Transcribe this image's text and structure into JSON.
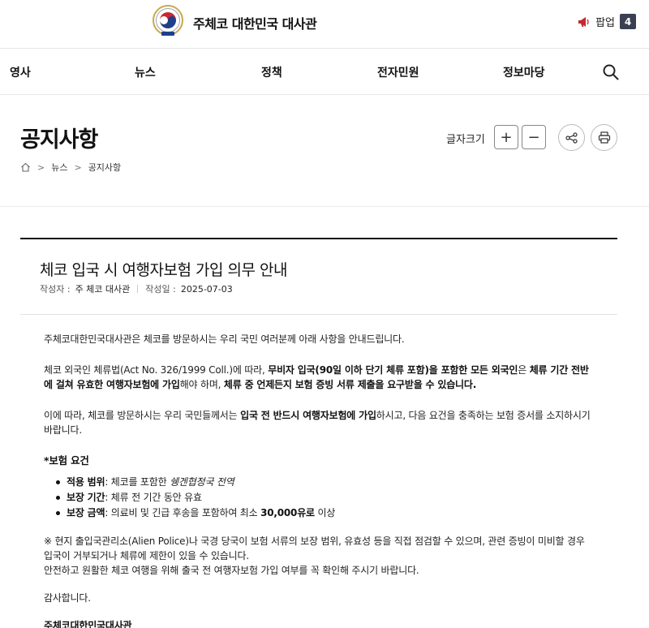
{
  "header": {
    "site_title": "주체코 대한민국 대사관",
    "popup_label": "팝업",
    "popup_count": "4"
  },
  "nav": {
    "items": [
      "영사",
      "뉴스",
      "정책",
      "전자민원",
      "정보마당"
    ]
  },
  "page": {
    "title": "공지사항",
    "breadcrumb": [
      "뉴스",
      "공지사항"
    ],
    "font_size_label": "글자크기",
    "plus": "+",
    "minus": "−"
  },
  "article": {
    "title": "체코 입국 시 여행자보험 가입 의무 안내",
    "author_label": "작성자 :",
    "author": "주 체코 대사관",
    "date_label": "작성일 :",
    "date": "2025-07-03",
    "p1": "주체코대한민국대사관은 체코를 방문하시는 우리 국민 여러분께 아래 사항을 안내드립니다.",
    "p2_a": "체코 외국인 체류법(Act No. 326/1999 Coll.)에 따라, ",
    "p2_b": "무비자 입국(90일 이하 단기 체류 포함)을 포함한 모든 외국인",
    "p2_c": "은 ",
    "p2_d": "체류 기간 전반에 걸쳐 유효한 여행자보험에 가입",
    "p2_e": "해야 하며, ",
    "p2_f": "체류 중 언제든지 보험 증빙 서류 제출을 요구받을 수 있습니다.",
    "p3_a": "이에 따라, 체코를 방문하시는 우리 국민들께서는 ",
    "p3_b": "입국 전 반드시 여행자보험에 가입",
    "p3_c": "하시고, 다음 요건을 충족하는 보험 증서를 소지하시기 바랍니다.",
    "req_title": "*보험 요건",
    "req1_label": "적용 범위",
    "req1_a": ": 체코를 포함한 ",
    "req1_b": "쉥겐협정국 전역",
    "req2_label": "보장 기간",
    "req2_a": ": 체류 전 기간 동안 유효",
    "req3_label": "보장 금액",
    "req3_a": ": 의료비 및 긴급 후송을 포함하여 최소 ",
    "req3_b": "30,000유로",
    "req3_c": " 이상",
    "note": "※ 현지 출입국관리소(Alien Police)나 국경 당국이 보험 서류의 보장 범위, 유효성 등을 직접 점검할 수 있으며, 관련 증빙이 미비할 경우 입국이 거부되거나 체류에 제한이 있을 수 있습니다.",
    "note2": "안전하고 원활한 체코 여행을 위해 출국 전 여행자보험 가입 여부를 꼭 확인해 주시기 바랍니다.",
    "thanks": "감사합니다.",
    "signature": "주체코대한민국대사관"
  },
  "colors": {
    "badge_bg": "#3a3f51",
    "emblem_red": "#c8282e",
    "emblem_blue": "#1e3f8c",
    "emblem_gold": "#c9a84a"
  },
  "icons": [
    "emblem-icon",
    "megaphone-icon",
    "search-icon",
    "home-icon",
    "share-icon",
    "print-icon"
  ]
}
